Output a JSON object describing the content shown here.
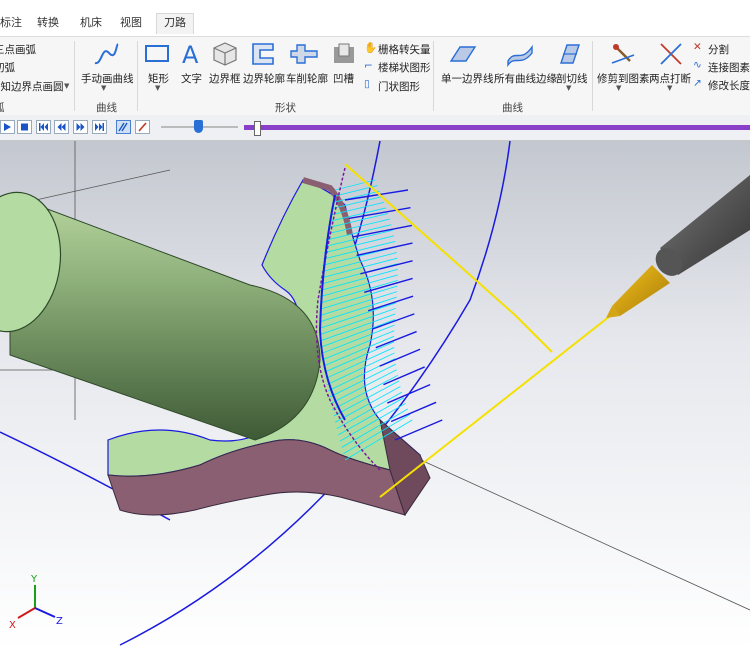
{
  "tabs": [
    {
      "label": "标注"
    },
    {
      "label": "转换"
    },
    {
      "label": "机床"
    },
    {
      "label": "视图"
    },
    {
      "label": "刀路",
      "active": true
    }
  ],
  "ribbon": {
    "arc_group": {
      "items": [
        "三点画弧",
        "切弧",
        "已知边界点画圆"
      ],
      "label": "弧"
    },
    "curve_group": {
      "manual_curve": "手动画曲线",
      "label": "曲线"
    },
    "shape_group": {
      "rectangle": "矩形",
      "text": "文字",
      "boundary_box": "边界框",
      "boundary_profile": "边界轮廓",
      "turning_profile": "车削轮廓",
      "groove": "凹槽",
      "grid_to_vector": "栅格转矢量",
      "stair_shape": "楼梯状图形",
      "door_shape": "门状图形",
      "label": "形状"
    },
    "curves_group": {
      "single_boundary": "单一边界线",
      "all_curve_edges": "所有曲线边缘",
      "section_line": "剖切线",
      "label": "曲线"
    },
    "modify_group": {
      "trim_to_entity": "修剪到图素",
      "two_point_break": "两点打断",
      "split": "分割",
      "connect_entities": "连接图素",
      "modify_length": "修改长度"
    }
  },
  "playback": {
    "progress": 0.02
  },
  "colors": {
    "accent": "#8a3fc9",
    "wire": "#1a1ae0",
    "toolpath": "#00e5ff",
    "guide": "#f5e000"
  },
  "axis": {
    "x": "X",
    "y": "Y",
    "z": "Z"
  }
}
